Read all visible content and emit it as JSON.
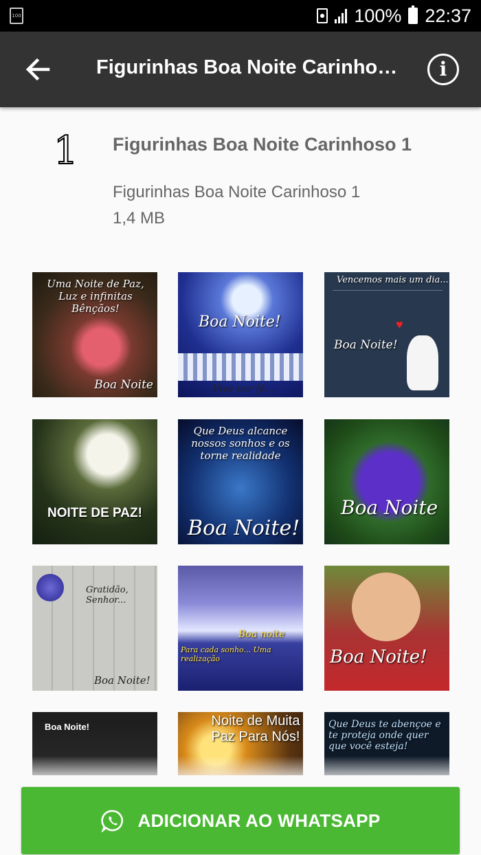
{
  "status_bar": {
    "left_icon_text": "100",
    "battery": "100%",
    "time": "22:37"
  },
  "app_bar": {
    "title": "Figurinhas Boa Noite Carinhoso..."
  },
  "pack": {
    "tray_icon_text": "1",
    "name": "Figurinhas Boa Noite Carinhoso 1",
    "publisher": "Figurinhas Boa Noite Carinhoso 1",
    "size": "1,4 MB"
  },
  "stickers": [
    {
      "caption": "Uma Noite de Paz, Luz e infinitas Bênçãos!",
      "caption2": "Boa Noite"
    },
    {
      "caption": "Boa Noite!",
      "caption2": "Viva por fé..."
    },
    {
      "caption": "Vencemos mais um dia...",
      "caption2": "Boa Noite!"
    },
    {
      "caption": "NOITE DE PAZ!",
      "caption2": ""
    },
    {
      "caption": "Que Deus alcance nossos sonhos e os torne realidade",
      "caption2": "Boa Noite!"
    },
    {
      "caption": "Boa Noite",
      "caption2": ""
    },
    {
      "caption": "Gratidão, Senhor...",
      "caption2": "Boa Noite!"
    },
    {
      "caption": "Boa noite",
      "caption2": "Para cada sonho... Uma realização"
    },
    {
      "caption": "Boa Noite!",
      "caption2": ""
    },
    {
      "caption": "Boa Noite!",
      "caption2": ""
    },
    {
      "caption": "Noite de Muita Paz Para Nós!",
      "caption2": ""
    },
    {
      "caption": "Que Deus te abençoe e te proteja onde quer que você esteja!",
      "caption2": ""
    }
  ],
  "add_button": {
    "label": "ADICIONAR AO WHATSAPP"
  },
  "colors": {
    "app_bar": "#333333",
    "button": "#4bb834"
  }
}
